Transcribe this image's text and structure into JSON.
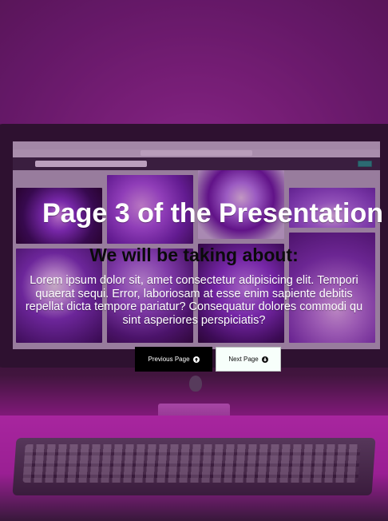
{
  "page": {
    "title": "Page 3 of the Presentation",
    "subtitle": "We will be taking about:",
    "paragraph_lines": [
      "Lorem ipsum dolor sit, amet consectetur adipisicing elit. Tempori",
      "quaerat sequi. Error, laboriosam at esse enim sapiente debitis",
      "repellat dicta tempore pariatur? Consequatur dolores commodi qu",
      "sint asperiores perspiciatis?"
    ]
  },
  "buttons": {
    "previous_label": "Previous Page",
    "next_label": "Next Page",
    "previous_icon": "arrow-up-circle-icon",
    "next_icon": "arrow-down-circle-icon"
  },
  "colors": {
    "prev_button_bg": "#000000",
    "next_button_bg": "#f7fffb",
    "title_text": "#ffffff",
    "subtitle_text": "#0b0b0b"
  }
}
